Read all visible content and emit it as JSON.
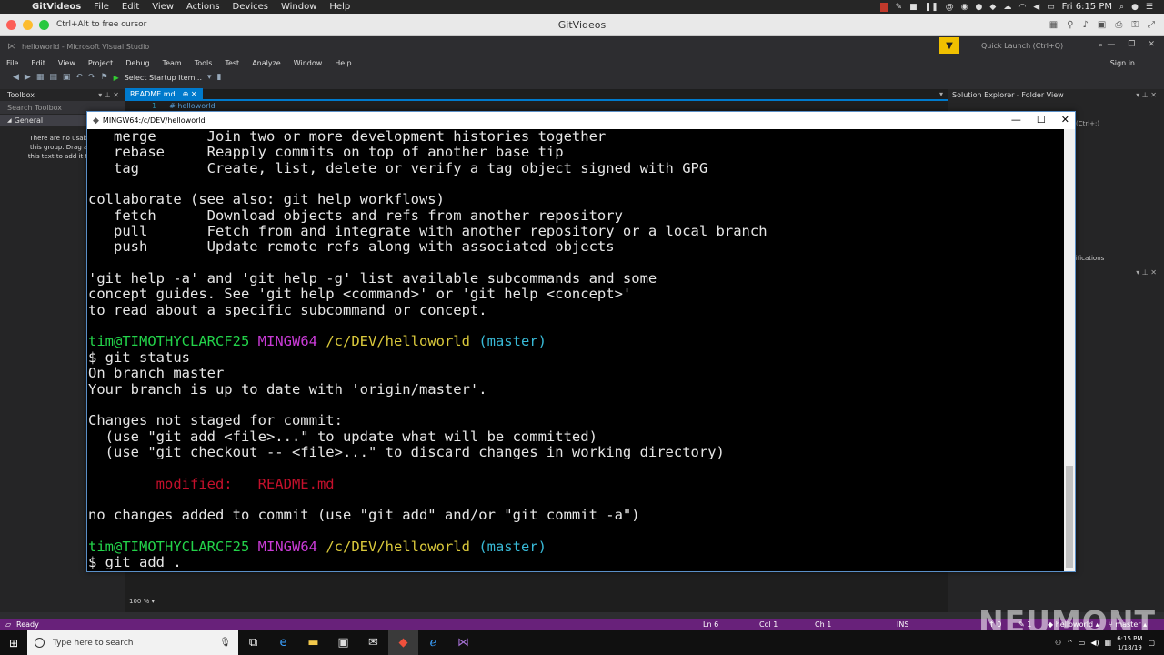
{
  "mac_menubar": {
    "app": "GitVideos",
    "items": [
      "File",
      "Edit",
      "View",
      "Actions",
      "Devices",
      "Window",
      "Help"
    ],
    "clock": "Fri 6:15 PM"
  },
  "mac_window": {
    "title": "GitVideos",
    "hint": "Ctrl+Alt to free cursor"
  },
  "vs": {
    "title": "helloworld - Microsoft Visual Studio",
    "quick_launch": "Quick Launch (Ctrl+Q)",
    "menu": [
      "File",
      "Edit",
      "View",
      "Project",
      "Debug",
      "Team",
      "Tools",
      "Test",
      "Analyze",
      "Window",
      "Help"
    ],
    "sign_in": "Sign in",
    "start_label": "Select Startup Item...",
    "toolbox": {
      "title": "Toolbox",
      "search": "Search Toolbox",
      "group": "General",
      "message_lines": [
        "There are no usable co",
        "this group. Drag an ite",
        "this text to add it to the"
      ]
    },
    "editor": {
      "tab": "README.md",
      "line_number": "1",
      "line_text": "# helloworld",
      "zoom": "100 %"
    },
    "solution_explorer": {
      "title": "Solution Explorer - Folder View",
      "frag_search": "(Ctrl+;)",
      "frag_notifications": "tifications"
    }
  },
  "terminal": {
    "title": "MINGW64:/c/DEV/helloworld",
    "lines": [
      {
        "segments": [
          {
            "t": "   merge      Join two or more development histories together",
            "c": ""
          }
        ]
      },
      {
        "segments": [
          {
            "t": "   rebase     Reapply commits on top of another base tip",
            "c": ""
          }
        ]
      },
      {
        "segments": [
          {
            "t": "   tag        Create, list, delete or verify a tag object signed with GPG",
            "c": ""
          }
        ]
      },
      {
        "segments": [
          {
            "t": "",
            "c": ""
          }
        ]
      },
      {
        "segments": [
          {
            "t": "collaborate (see also: git help workflows)",
            "c": ""
          }
        ]
      },
      {
        "segments": [
          {
            "t": "   fetch      Download objects and refs from another repository",
            "c": ""
          }
        ]
      },
      {
        "segments": [
          {
            "t": "   pull       Fetch from and integrate with another repository or a local branch",
            "c": ""
          }
        ]
      },
      {
        "segments": [
          {
            "t": "   push       Update remote refs along with associated objects",
            "c": ""
          }
        ]
      },
      {
        "segments": [
          {
            "t": "",
            "c": ""
          }
        ]
      },
      {
        "segments": [
          {
            "t": "'git help -a' and 'git help -g' list available subcommands and some",
            "c": ""
          }
        ]
      },
      {
        "segments": [
          {
            "t": "concept guides. See 'git help <command>' or 'git help <concept>'",
            "c": ""
          }
        ]
      },
      {
        "segments": [
          {
            "t": "to read about a specific subcommand or concept.",
            "c": ""
          }
        ]
      },
      {
        "segments": [
          {
            "t": "",
            "c": ""
          }
        ]
      },
      {
        "segments": [
          {
            "t": "tim@TIMOTHYCLARCF25",
            "c": "green"
          },
          {
            "t": " ",
            "c": ""
          },
          {
            "t": "MINGW64",
            "c": "magenta"
          },
          {
            "t": " ",
            "c": ""
          },
          {
            "t": "/c/DEV/helloworld",
            "c": "yellow"
          },
          {
            "t": " ",
            "c": ""
          },
          {
            "t": "(master)",
            "c": "cyan"
          }
        ]
      },
      {
        "segments": [
          {
            "t": "$ git status",
            "c": ""
          }
        ]
      },
      {
        "segments": [
          {
            "t": "On branch master",
            "c": ""
          }
        ]
      },
      {
        "segments": [
          {
            "t": "Your branch is up to date with 'origin/master'.",
            "c": ""
          }
        ]
      },
      {
        "segments": [
          {
            "t": "",
            "c": ""
          }
        ]
      },
      {
        "segments": [
          {
            "t": "Changes not staged for commit:",
            "c": ""
          }
        ]
      },
      {
        "segments": [
          {
            "t": "  (use \"git add <file>...\" to update what will be committed)",
            "c": ""
          }
        ]
      },
      {
        "segments": [
          {
            "t": "  (use \"git checkout -- <file>...\" to discard changes in working directory)",
            "c": ""
          }
        ]
      },
      {
        "segments": [
          {
            "t": "",
            "c": ""
          }
        ]
      },
      {
        "segments": [
          {
            "t": "        modified:   README.md",
            "c": "red"
          }
        ]
      },
      {
        "segments": [
          {
            "t": "",
            "c": ""
          }
        ]
      },
      {
        "segments": [
          {
            "t": "no changes added to commit (use \"git add\" and/or \"git commit -a\")",
            "c": ""
          }
        ]
      },
      {
        "segments": [
          {
            "t": "",
            "c": ""
          }
        ]
      },
      {
        "segments": [
          {
            "t": "tim@TIMOTHYCLARCF25",
            "c": "green"
          },
          {
            "t": " ",
            "c": ""
          },
          {
            "t": "MINGW64",
            "c": "magenta"
          },
          {
            "t": " ",
            "c": ""
          },
          {
            "t": "/c/DEV/helloworld",
            "c": "yellow"
          },
          {
            "t": " ",
            "c": ""
          },
          {
            "t": "(master)",
            "c": "cyan"
          }
        ]
      },
      {
        "segments": [
          {
            "t": "$ git add .",
            "c": ""
          }
        ]
      }
    ]
  },
  "statusbar": {
    "ready": "Ready",
    "ln": "Ln 6",
    "col": "Col 1",
    "ch": "Ch 1",
    "ins": "INS",
    "count1": "0",
    "count2": "1",
    "repo": "helloworld",
    "branch": "master"
  },
  "taskbar": {
    "search_placeholder": "Type here to search",
    "time": "6:15 PM",
    "date": "1/18/19",
    "apps": [
      "task-view",
      "edge",
      "file-explorer",
      "store",
      "mail",
      "git",
      "ie",
      "visual-studio"
    ]
  },
  "watermark": "NEUMONT",
  "colors": {
    "vs_accent": "#007acc",
    "status_bar": "#68217a",
    "prompt_user": "#23d34a",
    "prompt_mingw": "#c93bd6",
    "prompt_path": "#d9c83b",
    "prompt_branch": "#38b9d6",
    "modified": "#c4102b"
  }
}
